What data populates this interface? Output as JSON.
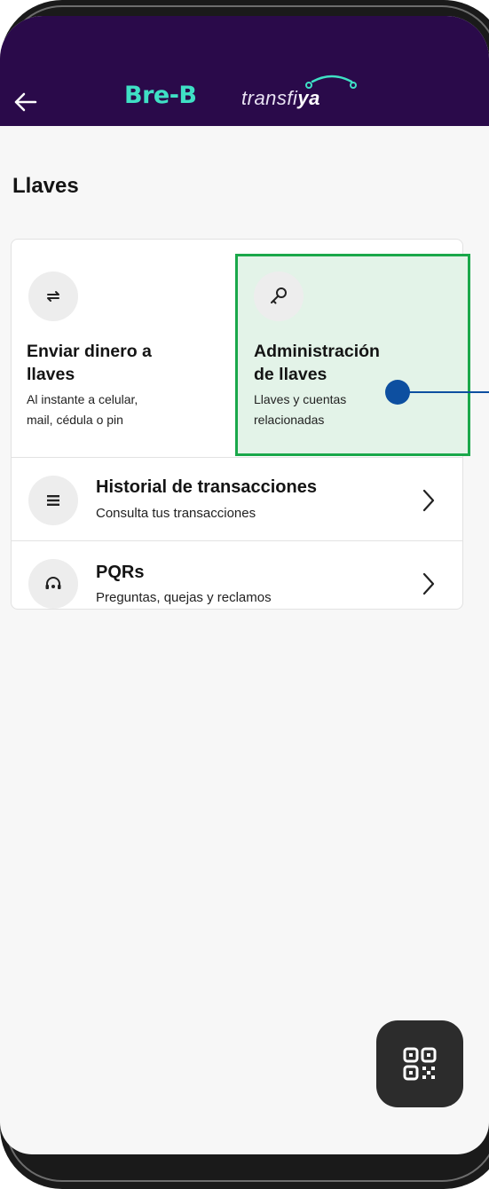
{
  "header": {
    "logo_primary": "Bre-B",
    "logo_secondary_a": "transfi",
    "logo_secondary_b": "ya"
  },
  "page": {
    "title": "Llaves"
  },
  "tiles": [
    {
      "title_line1": "Enviar dinero a",
      "title_line2": "llaves",
      "sub_line1": "Al instante a celular,",
      "sub_line2": "mail, cédula o pin",
      "icon": "swap-arrows-icon"
    },
    {
      "title_line1": "Administración",
      "title_line2": "de llaves",
      "sub_line1": "Llaves y cuentas",
      "sub_line2": "relacionadas",
      "icon": "key-icon",
      "highlighted": true
    }
  ],
  "rows": [
    {
      "title": "Historial de transacciones",
      "subtitle": "Consulta tus transacciones",
      "icon": "list-icon"
    },
    {
      "title": "PQRs",
      "subtitle": "Preguntas, quejas y reclamos",
      "icon": "support-headset-icon"
    }
  ],
  "colors": {
    "header_bg": "#2a0a4a",
    "logo_teal": "#3fe0c5",
    "highlight_border": "#1aa84a",
    "pointer": "#0d4fa0"
  }
}
